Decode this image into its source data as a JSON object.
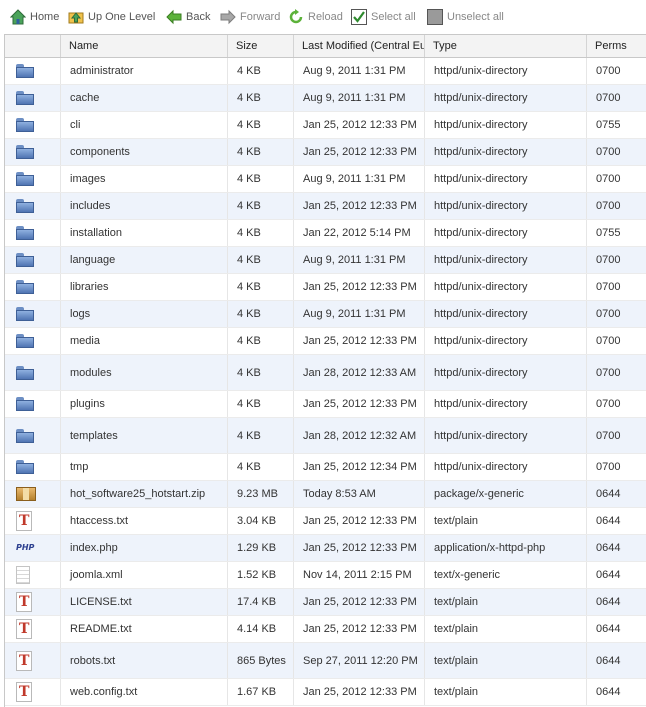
{
  "toolbar": {
    "home": "Home",
    "up_one_level": "Up One Level",
    "back": "Back",
    "forward": "Forward",
    "reload": "Reload",
    "select_all": "Select all",
    "unselect_all": "Unselect all"
  },
  "columns": {
    "name": "Name",
    "size": "Size",
    "modified": "Last Modified (Central Eu",
    "type": "Type",
    "perms": "Perms"
  },
  "files": [
    {
      "name": "administrator",
      "size": "4 KB",
      "modified": "Aug 9, 2011 1:31 PM",
      "type": "httpd/unix-directory",
      "perms": "0700",
      "icon": "folder-icon"
    },
    {
      "name": "cache",
      "size": "4 KB",
      "modified": "Aug 9, 2011 1:31 PM",
      "type": "httpd/unix-directory",
      "perms": "0700",
      "icon": "folder-icon"
    },
    {
      "name": "cli",
      "size": "4 KB",
      "modified": "Jan 25, 2012 12:33 PM",
      "type": "httpd/unix-directory",
      "perms": "0755",
      "icon": "folder-icon"
    },
    {
      "name": "components",
      "size": "4 KB",
      "modified": "Jan 25, 2012 12:33 PM",
      "type": "httpd/unix-directory",
      "perms": "0700",
      "icon": "folder-icon"
    },
    {
      "name": "images",
      "size": "4 KB",
      "modified": "Aug 9, 2011 1:31 PM",
      "type": "httpd/unix-directory",
      "perms": "0700",
      "icon": "folder-icon"
    },
    {
      "name": "includes",
      "size": "4 KB",
      "modified": "Jan 25, 2012 12:33 PM",
      "type": "httpd/unix-directory",
      "perms": "0700",
      "icon": "folder-icon"
    },
    {
      "name": "installation",
      "size": "4 KB",
      "modified": "Jan 22, 2012 5:14 PM",
      "type": "httpd/unix-directory",
      "perms": "0755",
      "icon": "folder-icon"
    },
    {
      "name": "language",
      "size": "4 KB",
      "modified": "Aug 9, 2011 1:31 PM",
      "type": "httpd/unix-directory",
      "perms": "0700",
      "icon": "folder-icon"
    },
    {
      "name": "libraries",
      "size": "4 KB",
      "modified": "Jan 25, 2012 12:33 PM",
      "type": "httpd/unix-directory",
      "perms": "0700",
      "icon": "folder-icon"
    },
    {
      "name": "logs",
      "size": "4 KB",
      "modified": "Aug 9, 2011 1:31 PM",
      "type": "httpd/unix-directory",
      "perms": "0700",
      "icon": "folder-icon"
    },
    {
      "name": "media",
      "size": "4 KB",
      "modified": "Jan 25, 2012 12:33 PM",
      "type": "httpd/unix-directory",
      "perms": "0700",
      "icon": "folder-icon"
    },
    {
      "name": "modules",
      "size": "4 KB",
      "modified": "Jan 28, 2012 12:33 AM",
      "type": "httpd/unix-directory",
      "perms": "0700",
      "icon": "folder-icon"
    },
    {
      "name": "plugins",
      "size": "4 KB",
      "modified": "Jan 25, 2012 12:33 PM",
      "type": "httpd/unix-directory",
      "perms": "0700",
      "icon": "folder-icon"
    },
    {
      "name": "templates",
      "size": "4 KB",
      "modified": "Jan 28, 2012 12:32 AM",
      "type": "httpd/unix-directory",
      "perms": "0700",
      "icon": "folder-icon"
    },
    {
      "name": "tmp",
      "size": "4 KB",
      "modified": "Jan 25, 2012 12:34 PM",
      "type": "httpd/unix-directory",
      "perms": "0700",
      "icon": "folder-icon"
    },
    {
      "name": "hot_software25_hotstart.zip",
      "size": "9.23 MB",
      "modified": "Today 8:53 AM",
      "type": "package/x-generic",
      "perms": "0644",
      "icon": "package-icon"
    },
    {
      "name": "htaccess.txt",
      "size": "3.04 KB",
      "modified": "Jan 25, 2012 12:33 PM",
      "type": "text/plain",
      "perms": "0644",
      "icon": "text-file-icon"
    },
    {
      "name": "index.php",
      "size": "1.29 KB",
      "modified": "Jan 25, 2012 12:33 PM",
      "type": "application/x-httpd-php",
      "perms": "0644",
      "icon": "php-file-icon"
    },
    {
      "name": "joomla.xml",
      "size": "1.52 KB",
      "modified": "Nov 14, 2011 2:15 PM",
      "type": "text/x-generic",
      "perms": "0644",
      "icon": "xml-file-icon"
    },
    {
      "name": "LICENSE.txt",
      "size": "17.4 KB",
      "modified": "Jan 25, 2012 12:33 PM",
      "type": "text/plain",
      "perms": "0644",
      "icon": "text-file-icon"
    },
    {
      "name": "README.txt",
      "size": "4.14 KB",
      "modified": "Jan 25, 2012 12:33 PM",
      "type": "text/plain",
      "perms": "0644",
      "icon": "text-file-icon"
    },
    {
      "name": "robots.txt",
      "size": "865 Bytes",
      "modified": "Sep 27, 2011 12:20 PM",
      "type": "text/plain",
      "perms": "0644",
      "icon": "text-file-icon"
    },
    {
      "name": "web.config.txt",
      "size": "1.67 KB",
      "modified": "Jan 25, 2012 12:33 PM",
      "type": "text/plain",
      "perms": "0644",
      "icon": "text-file-icon"
    }
  ],
  "colors": {
    "row_alt": "#eef3fb",
    "header_bg": "#f3f3f3",
    "folder_blue": "#4f74b3"
  }
}
